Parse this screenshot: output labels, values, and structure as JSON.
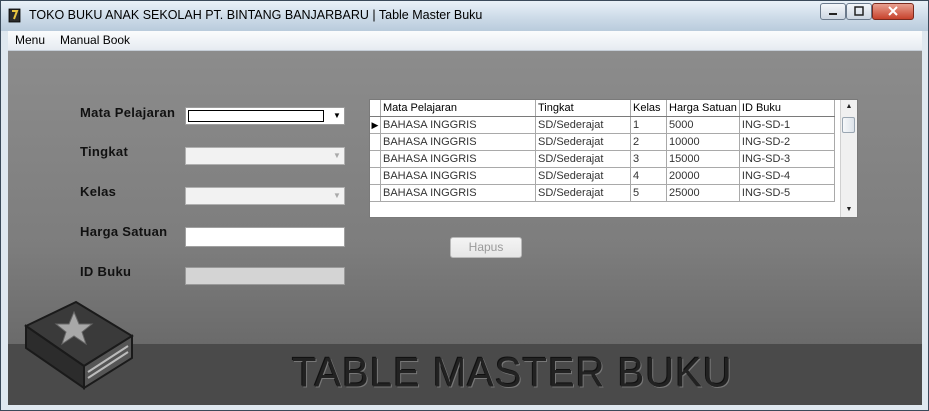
{
  "window": {
    "title": "TOKO BUKU ANAK SEKOLAH PT. BINTANG BANJARBARU | Table Master Buku",
    "controls": {
      "minimize": "minimize-icon",
      "maximize": "maximize-icon",
      "close": "close-icon"
    }
  },
  "menu": {
    "items": [
      "Menu",
      "Manual Book"
    ]
  },
  "form": {
    "mata_pelajaran_label": "Mata Pelajaran",
    "tingkat_label": "Tingkat",
    "kelas_label": "Kelas",
    "harga_label": "Harga Satuan",
    "id_label": "ID Buku",
    "mata_pelajaran_value": "",
    "tingkat_value": "",
    "kelas_value": "",
    "harga_value": "",
    "id_value": ""
  },
  "grid": {
    "columns": [
      "Mata Pelajaran",
      "Tingkat",
      "Kelas",
      "Harga Satuan",
      "ID Buku"
    ],
    "rows": [
      [
        "BAHASA INGGRIS",
        "SD/Sederajat",
        "1",
        "5000",
        "ING-SD-1"
      ],
      [
        "BAHASA INGGRIS",
        "SD/Sederajat",
        "2",
        "10000",
        "ING-SD-2"
      ],
      [
        "BAHASA INGGRIS",
        "SD/Sederajat",
        "3",
        "15000",
        "ING-SD-3"
      ],
      [
        "BAHASA INGGRIS",
        "SD/Sederajat",
        "4",
        "20000",
        "ING-SD-4"
      ],
      [
        "BAHASA INGGRIS",
        "SD/Sederajat",
        "5",
        "25000",
        "ING-SD-5"
      ]
    ],
    "current_row_index": 0
  },
  "buttons": {
    "hapus": "Hapus"
  },
  "banner": {
    "text": "TABLE MASTER BUKU"
  },
  "colors": {
    "background": "#7d7d7d",
    "banner": "#4a4a4a",
    "titlebar": "#cddbe8"
  },
  "icons": {
    "app": "book-app-icon",
    "decoration": "book-star-icon"
  }
}
